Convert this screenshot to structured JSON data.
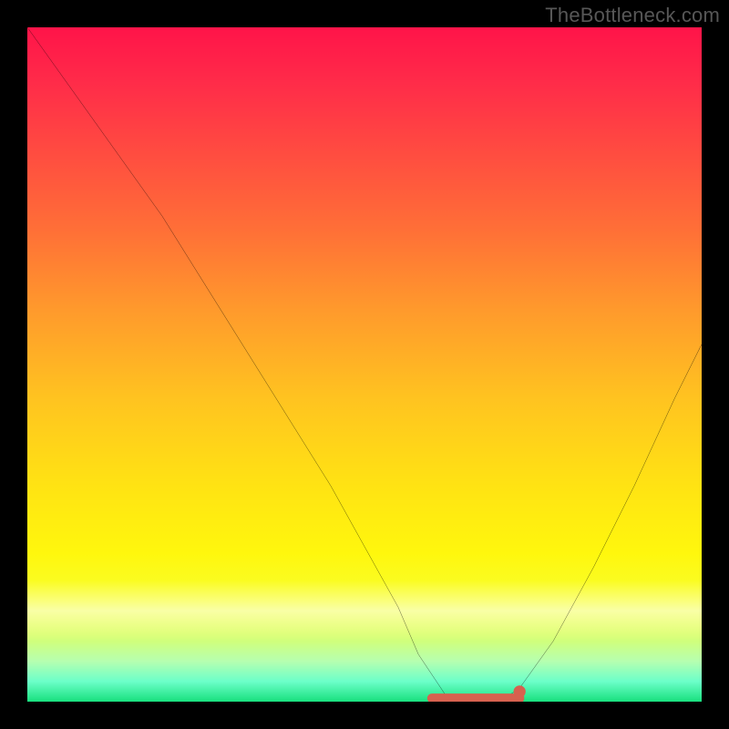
{
  "watermark": "TheBottleneck.com",
  "chart_data": {
    "type": "line",
    "title": "",
    "xlabel": "",
    "ylabel": "",
    "xlim": [
      0,
      100
    ],
    "ylim": [
      0,
      100
    ],
    "curve": {
      "name": "bottleneck-curve",
      "x": [
        0,
        5,
        10,
        15,
        20,
        25,
        30,
        35,
        40,
        45,
        50,
        55,
        58,
        62,
        66,
        70,
        73,
        78,
        84,
        90,
        96,
        100
      ],
      "y": [
        100,
        93,
        86,
        79,
        72,
        64,
        56,
        48,
        40,
        32,
        23,
        14,
        7,
        1,
        0,
        0,
        2,
        9,
        20,
        32,
        45,
        53
      ]
    },
    "flat_zone": {
      "x_start": 60,
      "x_end": 73,
      "y": 0.5
    },
    "dot_marker": {
      "x": 73,
      "y": 1.5,
      "r": 0.9
    },
    "colors": {
      "curve": "#000000",
      "flat_zone": "#d6614f",
      "dot_marker": "#d6614f",
      "background_top": "#ff1449",
      "background_bottom": "#18e07e",
      "frame": "#000000",
      "watermark": "#575757"
    }
  }
}
